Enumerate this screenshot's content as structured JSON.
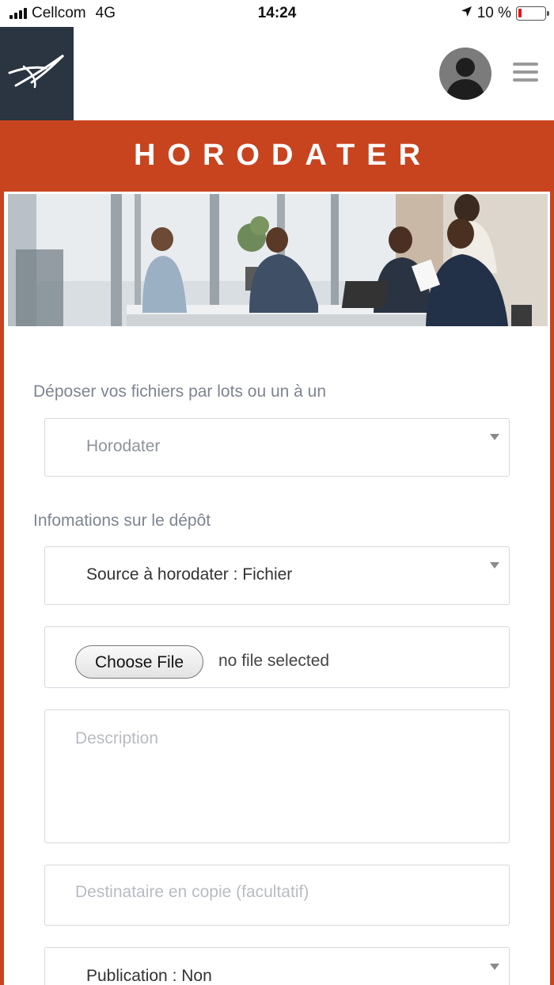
{
  "status_bar": {
    "carrier": "Cellcom",
    "network": "4G",
    "time": "14:24",
    "battery": "10 %"
  },
  "header": {
    "title": "HORODATER"
  },
  "form": {
    "section_deposit_label": "Déposer vos fichiers par lots ou un à un",
    "deposit_select_value": "Horodater",
    "section_info_label": "Infomations sur le dépôt",
    "source_select_value": "Source à horodater : Fichier",
    "choose_file_label": "Choose File",
    "no_file_text": "no file selected",
    "description_placeholder": "Description",
    "cc_placeholder": "Destinataire en copie (facultatif)",
    "publication_select_value": "Publication : Non"
  },
  "colors": {
    "brand": "#c8441f",
    "logo_bg": "#2b3441"
  },
  "icons": {
    "logo": "brand-swoosh-icon",
    "avatar": "user-avatar-icon",
    "menu": "hamburger-menu-icon",
    "location": "location-arrow-icon"
  }
}
